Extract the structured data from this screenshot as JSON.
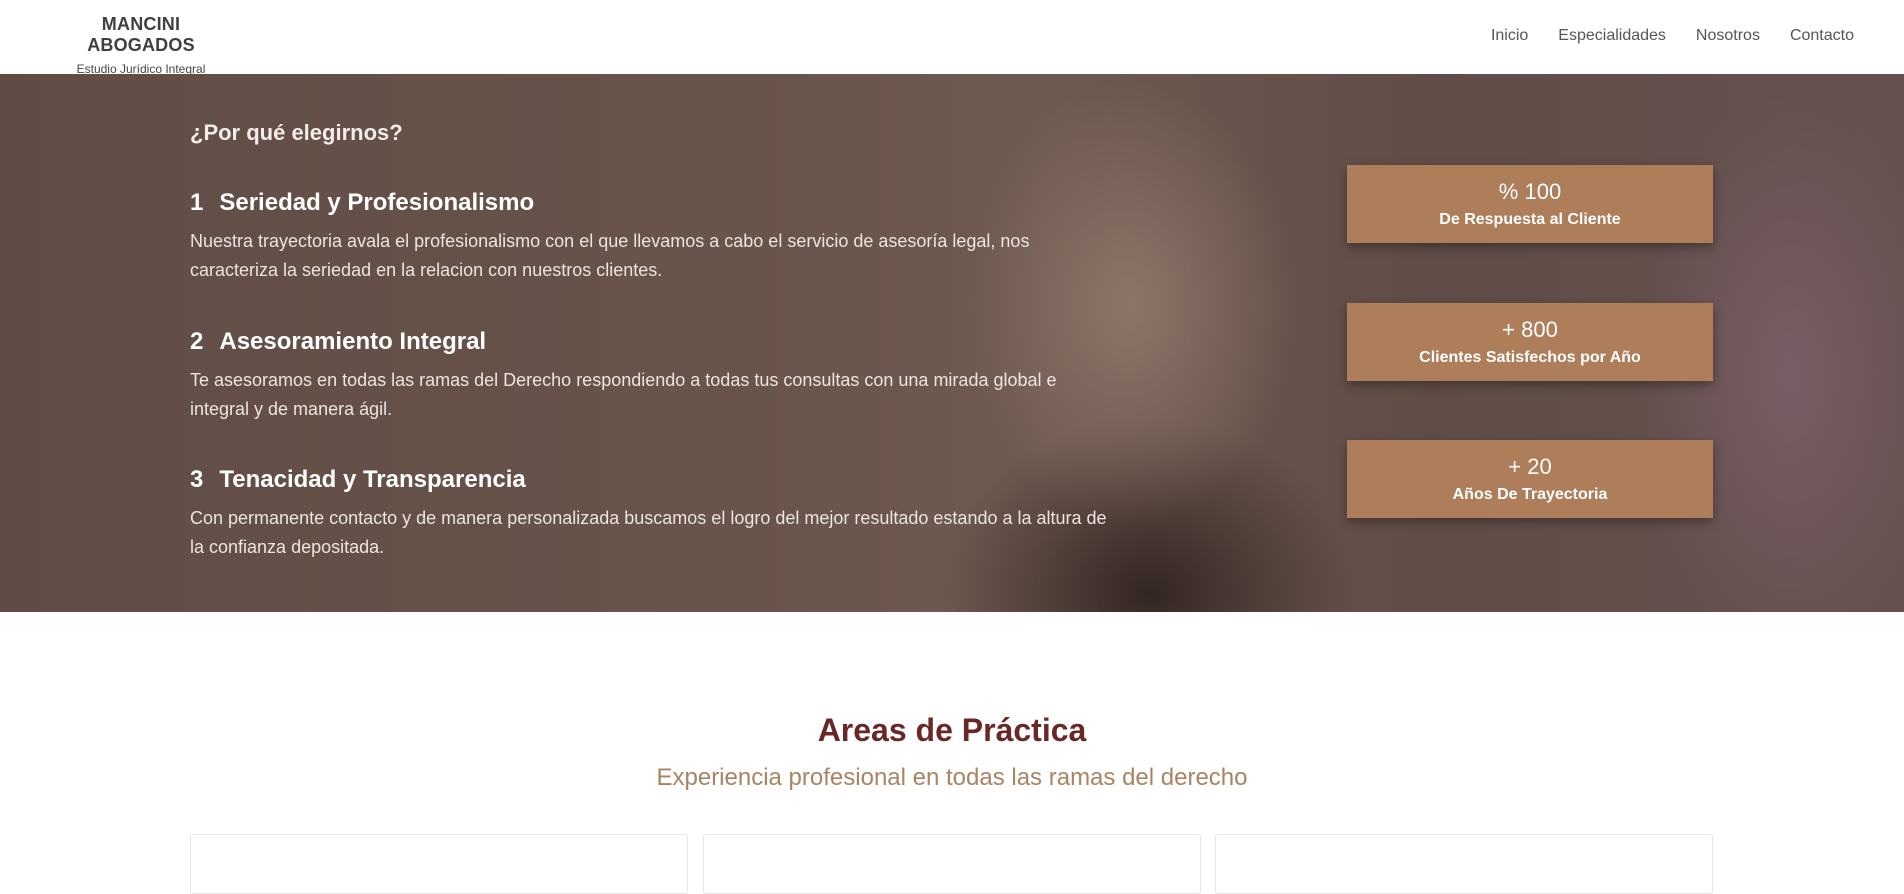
{
  "brand": {
    "title": "MANCINI ABOGADOS",
    "subtitle": "Estudio Jurídico Integral"
  },
  "nav": [
    {
      "label": "Inicio"
    },
    {
      "label": "Especialidades"
    },
    {
      "label": "Nosotros"
    },
    {
      "label": "Contacto"
    }
  ],
  "hero": {
    "heading": "¿Por qué elegirnos?",
    "features": [
      {
        "number": "1",
        "title": "Seriedad y Profesionalismo",
        "text": "Nuestra trayectoria avala el profesionalismo con el que llevamos a cabo el servicio de asesoría legal, nos caracteriza la seriedad en la relacion con nuestros clientes."
      },
      {
        "number": "2",
        "title": "Asesoramiento Integral",
        "text": "Te asesoramos en todas las ramas del Derecho respondiendo a todas tus consultas con una mirada global e integral y de manera ágil."
      },
      {
        "number": "3",
        "title": "Tenacidad y Transparencia",
        "text": "Con permanente contacto y de manera personalizada buscamos el logro del mejor resultado estando a la altura de la confianza depositada."
      }
    ],
    "stats": [
      {
        "value": "% 100",
        "label": "De Respuesta al Cliente"
      },
      {
        "value": "+ 800",
        "label": "Clientes Satisfechos por Año"
      },
      {
        "value": "+ 20",
        "label": "Años De Trayectoria"
      }
    ]
  },
  "practice": {
    "title": "Areas de Práctica",
    "subtitle": "Experiencia profesional en todas las ramas del derecho"
  },
  "colors": {
    "accent": "#ae7d59",
    "title": "#6b2626",
    "subtitle": "#a98463"
  }
}
